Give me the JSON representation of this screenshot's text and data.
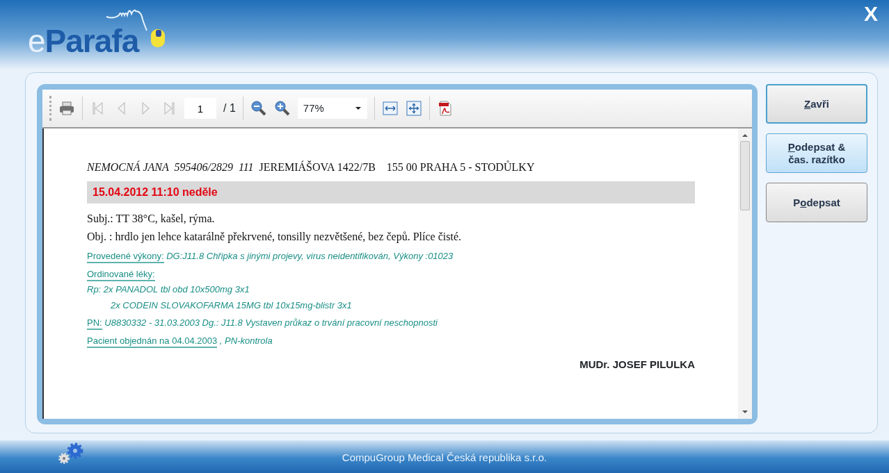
{
  "window": {
    "logo_prefix": "e",
    "logo_name": "Parafa",
    "close": "X"
  },
  "toolbar": {
    "nav": [
      {
        "kind": "first",
        "disabled": true
      },
      {
        "kind": "prev",
        "disabled": true
      },
      {
        "kind": "next",
        "disabled": true
      },
      {
        "kind": "last",
        "disabled": true
      }
    ],
    "page": "1",
    "page_total": "/ 1",
    "zoom": "77%"
  },
  "document": {
    "header": "*NEMOCNÁ JANA  595406/2829  111*  JEREMIÁŠOVA 1422/7B    155 00 PRAHA 5 - STODŮLKY",
    "date": "15.04.2012 11:10 neděle",
    "lines": [
      {
        "kind": "plain",
        "text": "Subj.:  TT 38°C, kašel, rýma."
      },
      {
        "kind": "plain",
        "text": "Obj. : hrdlo jen lehce katarálně překrvené, tonsilly nezvětšené, bez čepů. Plíce čisté."
      },
      {
        "kind": "labeled",
        "label": "Provedené výkony:",
        "text": "DG:J11.8 Chřipka s jinými projevy, virus neidentifikován, Výkony :01023"
      },
      {
        "kind": "labeled",
        "label": "Ordinované léky:"
      },
      {
        "kind": "italic",
        "text": "Rp: 2x PANADOL tbl obd 10x500mg 3x1"
      },
      {
        "kind": "indented",
        "text": "2x CODEIN SLOVAKOFARMA 15MG tbl 10x15mg-blistr  3x1"
      },
      {
        "kind": "labeled",
        "label": "PN:",
        "text": "U8830332 - 31.03.2003 Dg.: J11.8 Vystaven průkaz o trvání pracovní neschopnosti"
      },
      {
        "kind": "labeled",
        "label": "Pacient objednán na 04.04.2003",
        "text": ", PN-kontrola"
      }
    ],
    "signature": "MUDr. JOSEF PILULKA"
  },
  "buttons": [
    {
      "key": "Z",
      "rest": "avři",
      "kind": "focused"
    },
    {
      "key": "P",
      "rest": "odepsat & čas. razítko",
      "kind": "hover"
    },
    {
      "before": "P",
      "key": "o",
      "rest": "depsat",
      "kind": "normal"
    }
  ],
  "footer": "CompuGroup Medical Česká republika s.r.o."
}
